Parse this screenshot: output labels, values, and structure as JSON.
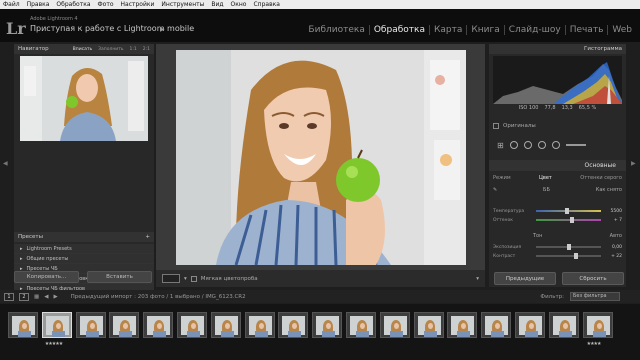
{
  "menu": [
    "Файл",
    "Правка",
    "Обработка",
    "Фото",
    "Настройки",
    "Инструменты",
    "Вид",
    "Окно",
    "Справка"
  ],
  "app": {
    "logo": "Lr",
    "name": "Adobe Lightroom 4",
    "catalog": "Приступая к работе с Lightroom mobile"
  },
  "modules": [
    "Библиотека",
    "Обработка",
    "Карта",
    "Книга",
    "Слайд-шоу",
    "Печать",
    "Web"
  ],
  "left": {
    "navigator_title": "Навигатор",
    "nav_tabs": [
      "Вписать",
      "Заполнить",
      "1:1",
      "2:1"
    ],
    "presets_title": "Пресеты",
    "presets": [
      "Lightroom Presets",
      "Общие пресеты",
      "Пресеты ЧБ",
      "Пресеты ЧБ с тонировкой",
      "Пресеты ЧБ фильтров"
    ],
    "copy_button": "Копировать...",
    "paste_button": "Вставить"
  },
  "toolbar": {
    "softproof": "Мягкая цветопроба"
  },
  "right": {
    "histogram_title": "Гистограмма",
    "exif": [
      "ISO 100",
      "77,8",
      "13,3",
      "65,5 %"
    ],
    "original_label": "Оригиналы",
    "basic_title": "Основные",
    "treatment_label": "Режим",
    "treatment_options": [
      "Цвет",
      "Оттенки серого"
    ],
    "wb_label": "ББ",
    "wb_value": "Как снято",
    "sliders": [
      {
        "label": "Температура",
        "value": "5500"
      },
      {
        "label": "Оттенок",
        "value": "+ 7"
      }
    ],
    "tone_label": "Тон",
    "tone_auto": "Авто",
    "sliders2": [
      {
        "label": "Экспозиция",
        "value": "0,00"
      },
      {
        "label": "Контраст",
        "value": "+ 22"
      }
    ],
    "previous_button": "Предыдущие",
    "reset_button": "Сбросить"
  },
  "filmstrip_bar": {
    "page1": "1",
    "page2": "2",
    "source": "Предыдущий импорт : 203 фото / 1 выбрано / IMG_6123.CR2",
    "filter_label": "Фильтр:",
    "filter_value": "Без фильтра"
  },
  "filmstrip": {
    "count": 18,
    "selected_index": 1,
    "selected_stars": "★★★★★",
    "last_stars": "★★★★"
  },
  "colors": {
    "background": "#1e1e1e",
    "panel": "#282828",
    "accent": "#eaeaea",
    "apple": "#7ec82c"
  }
}
